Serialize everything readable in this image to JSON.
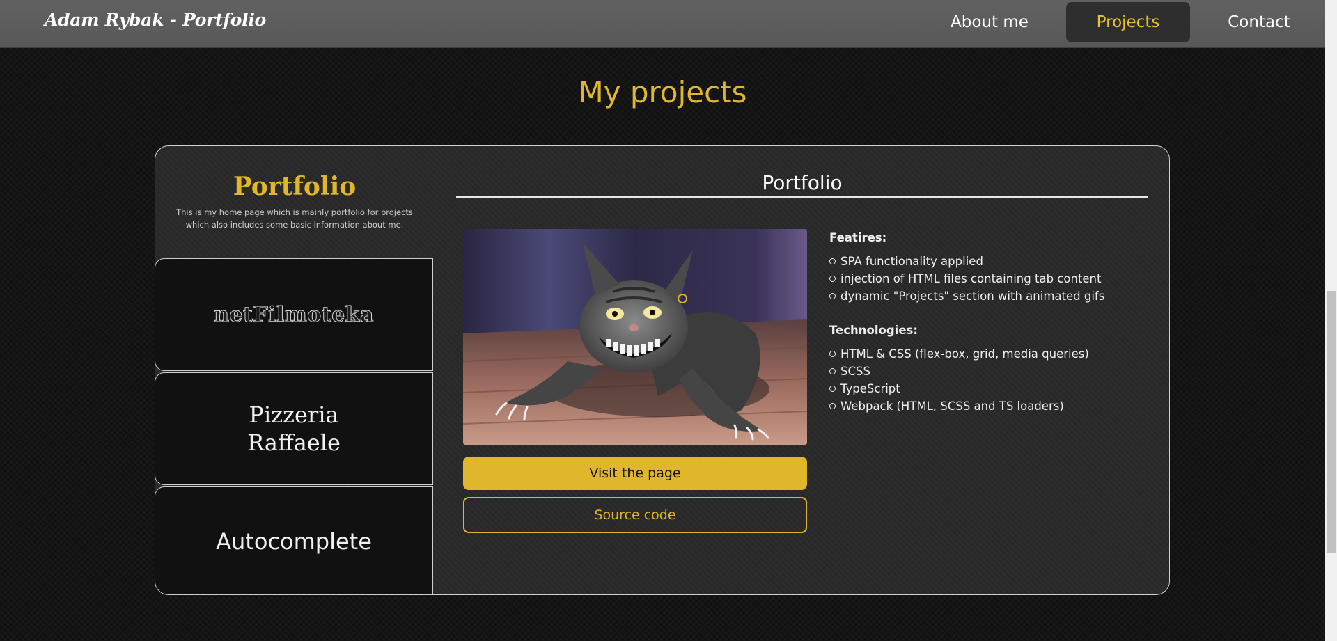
{
  "header": {
    "brand": "Adam Rybak - Portfolio",
    "nav": [
      {
        "label": "About me",
        "active": false
      },
      {
        "label": "Projects",
        "active": true
      },
      {
        "label": "Contact",
        "active": false
      }
    ]
  },
  "page": {
    "title": "My projects"
  },
  "sidebar": {
    "active_title": "Portfolio",
    "active_description": "This is my home page which is mainly portfolio for projects which also includes some basic information about me.",
    "tabs": [
      {
        "label": "netFilmoteka"
      },
      {
        "label_line1": "Pizzeria",
        "label_line2": "Raffaele"
      },
      {
        "label": "Autocomplete"
      }
    ]
  },
  "detail": {
    "title": "Portfolio",
    "preview_icon": "grinning-cat-illustration",
    "visit_label": "Visit the page",
    "source_label": "Source code",
    "features_heading": "Featires:",
    "features": [
      "SPA functionality applied",
      "injection of HTML files containing tab content",
      "dynamic \"Projects\" section with animated gifs"
    ],
    "technologies_heading": "Technologies:",
    "technologies": [
      "HTML & CSS (flex-box, grid, media queries)",
      "SCSS",
      "TypeScript",
      "Webpack (HTML, SCSS and TS loaders)"
    ]
  },
  "colors": {
    "accent": "#e0b72c",
    "background": "#141414",
    "header": "#5c5c5c",
    "active_nav_bg": "#2e2e2e"
  }
}
